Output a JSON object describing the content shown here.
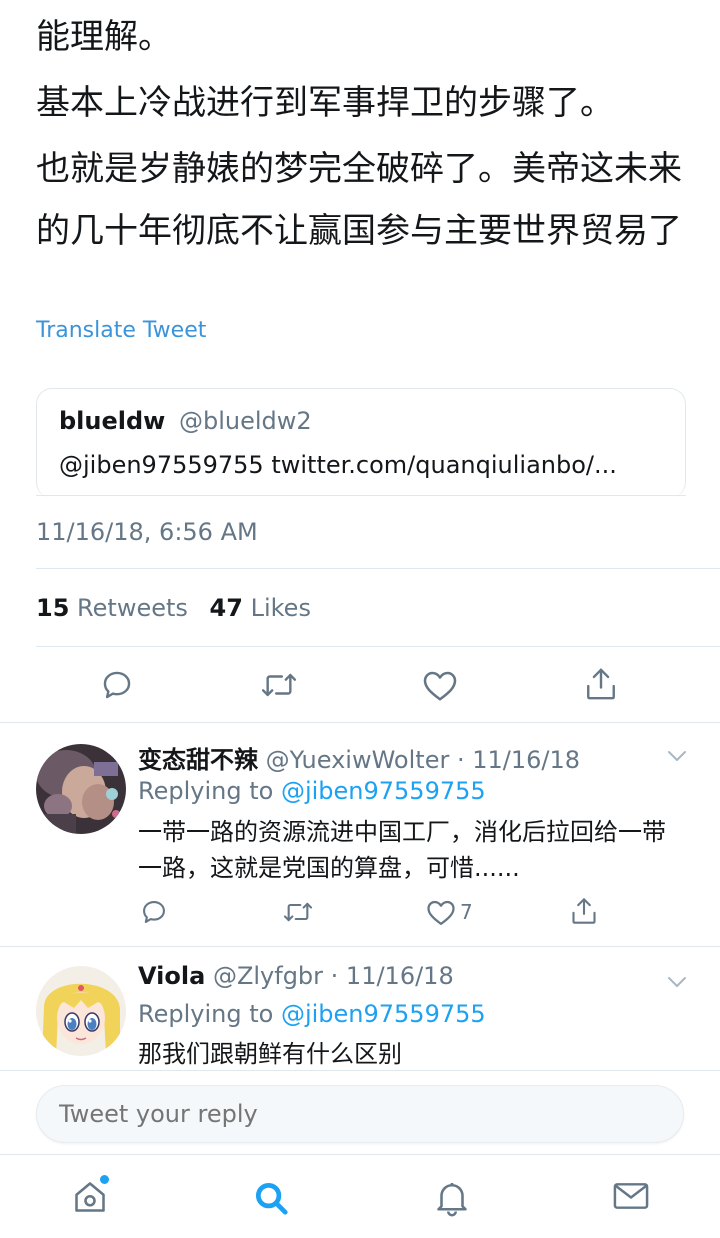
{
  "tweet": {
    "lines": [
      "能理解。",
      "基本上冷战进行到军事捍卫的步骤了。",
      "也就是岁静婊的梦完全破碎了。美帝这未来的几十年彻底不让赢国参与主要世界贸易了"
    ],
    "translate_label": "Translate Tweet",
    "quote": {
      "name": "blueldw",
      "handle": "@blueldw2",
      "body": "@jiben97559755 twitter.com/quanqiulianbo/..."
    },
    "timestamp": "11/16/18, 6:56 AM",
    "stats": {
      "retweets_count": "15",
      "retweets_label": "Retweets",
      "likes_count": "47",
      "likes_label": "Likes"
    }
  },
  "replies": [
    {
      "name": "变态甜不辣",
      "meta": "@YuexiwWolter · 11/16/18",
      "replying_prefix": "Replying to",
      "mention": "@jiben97559755",
      "text": "一带一路的资源流进中国工厂，消化后拉回给一带一路，这就是党国的算盘，可惜......",
      "like_count": "7"
    },
    {
      "name": "Viola",
      "meta": "@Zlyfgbr · 11/16/18",
      "replying_prefix": "Replying to",
      "mention": "@jiben97559755",
      "text": "那我们跟朝鲜有什么区别"
    }
  ],
  "composer": {
    "placeholder": "Tweet your reply"
  },
  "icons": {
    "reply": "reply-icon",
    "retweet": "retweet-icon",
    "like": "heart-icon",
    "share": "share-icon",
    "chevron": "chevron-down-icon",
    "home": "home-icon",
    "search": "search-icon",
    "notifications": "bell-icon",
    "messages": "mail-icon"
  },
  "colors": {
    "accent": "#1da1f2",
    "link": "#3b94d9",
    "secondary_text": "#657786",
    "icon_gray": "#657786",
    "divider": "#e1e8ed"
  }
}
